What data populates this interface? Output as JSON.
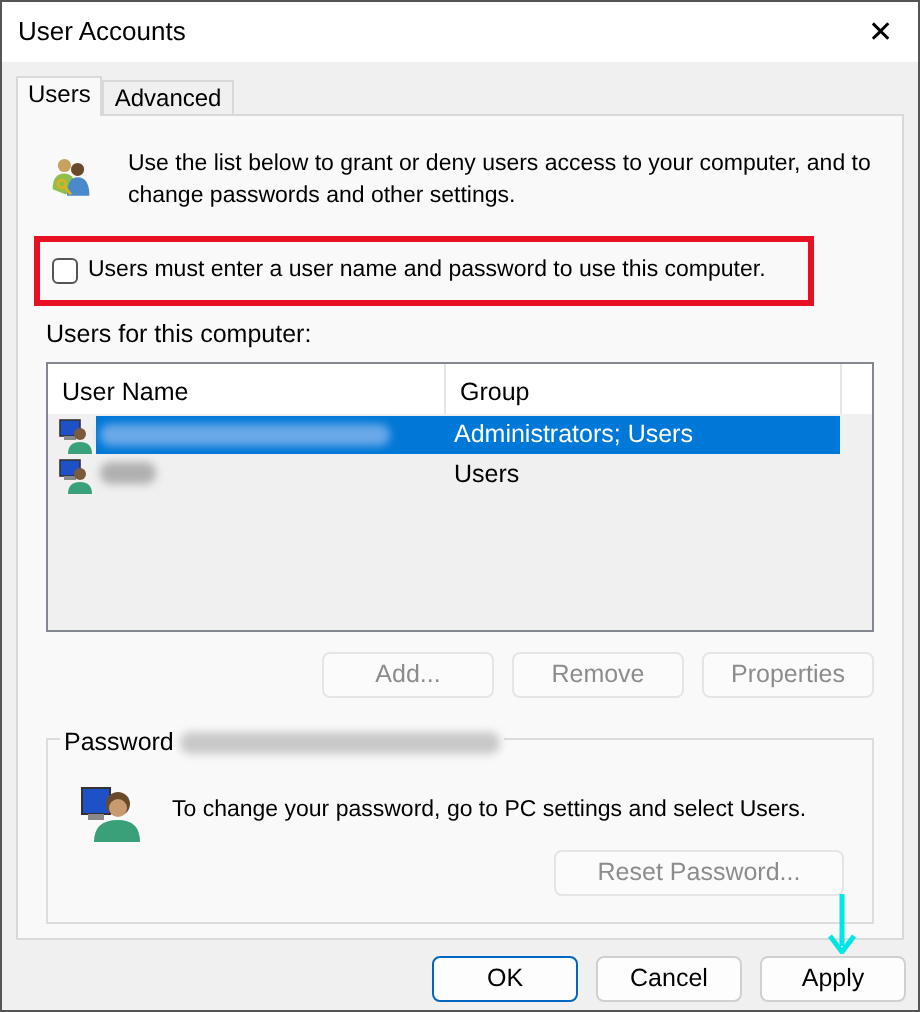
{
  "window": {
    "title": "User Accounts",
    "close": "✕"
  },
  "tabs": [
    {
      "label": "Users",
      "selected": true
    },
    {
      "label": "Advanced",
      "selected": false
    }
  ],
  "intro": "Use the list below to grant or deny users access to your computer, and to change passwords and other settings.",
  "require_password": {
    "label": "Users must enter a user name and password to use this computer.",
    "checked": false,
    "highlighted": true
  },
  "users_label": "Users for this computer:",
  "table": {
    "columns": [
      "User Name",
      "Group"
    ],
    "rows": [
      {
        "group": "Administrators; Users",
        "selected": true,
        "name_redacted": true
      },
      {
        "group": "Users",
        "selected": false,
        "name_redacted": true
      }
    ]
  },
  "list_buttons": [
    {
      "label": "Add...",
      "disabled": true
    },
    {
      "label": "Remove",
      "disabled": true
    },
    {
      "label": "Properties",
      "disabled": true
    }
  ],
  "password_group": {
    "legend": "Password",
    "legend_redacted": true,
    "text": "To change your password, go to PC settings and select Users.",
    "button": {
      "label": "Reset Password...",
      "disabled": true
    }
  },
  "dialog_buttons": [
    {
      "label": "OK",
      "default": true,
      "pointed": false
    },
    {
      "label": "Cancel",
      "default": false,
      "pointed": false
    },
    {
      "label": "Apply",
      "default": false,
      "pointed": true
    }
  ]
}
